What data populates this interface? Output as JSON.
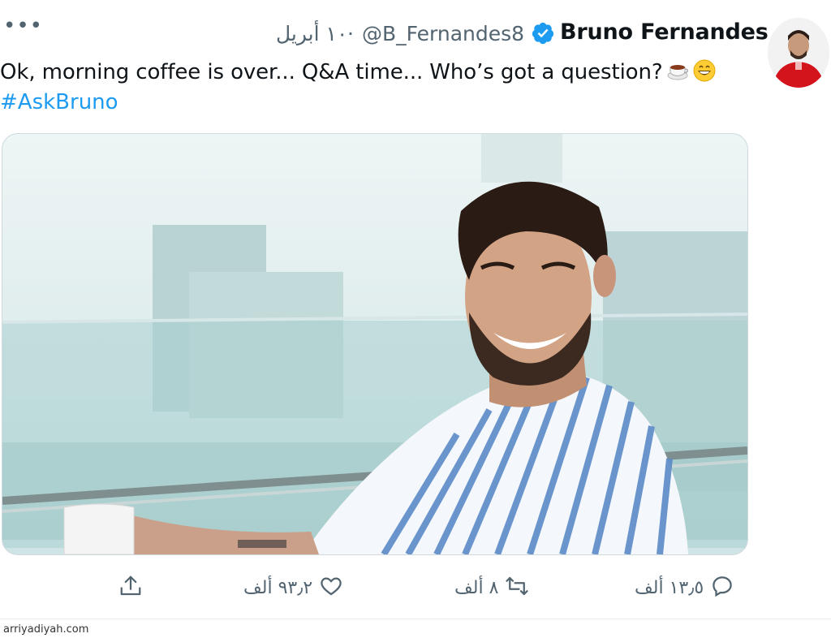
{
  "author": {
    "name": "Bruno Fernandes",
    "handle": "@B_Fernandes8",
    "separator": "·",
    "date": "١٠ أبريل",
    "avatar_icon": "profile-photo",
    "verified_icon": "verified-badge-icon"
  },
  "tweet": {
    "text": "Ok, morning coffee is over... Q&A time... Who’s got a question?",
    "hashtag": "#AskBruno",
    "emojis": [
      "coffee-icon",
      "grinning-face-icon"
    ]
  },
  "actions": {
    "reply_count": "١٣٫٥ ألف",
    "retweet_count": "٨ ألف",
    "like_count": "٩٣٫٢ ألف"
  },
  "more_label": "•••",
  "watermark": "arriyadiyah.com",
  "colors": {
    "link": "#1d9bf0",
    "verified": "#1d9bf0",
    "muted": "#536471",
    "text": "#0f1419"
  }
}
